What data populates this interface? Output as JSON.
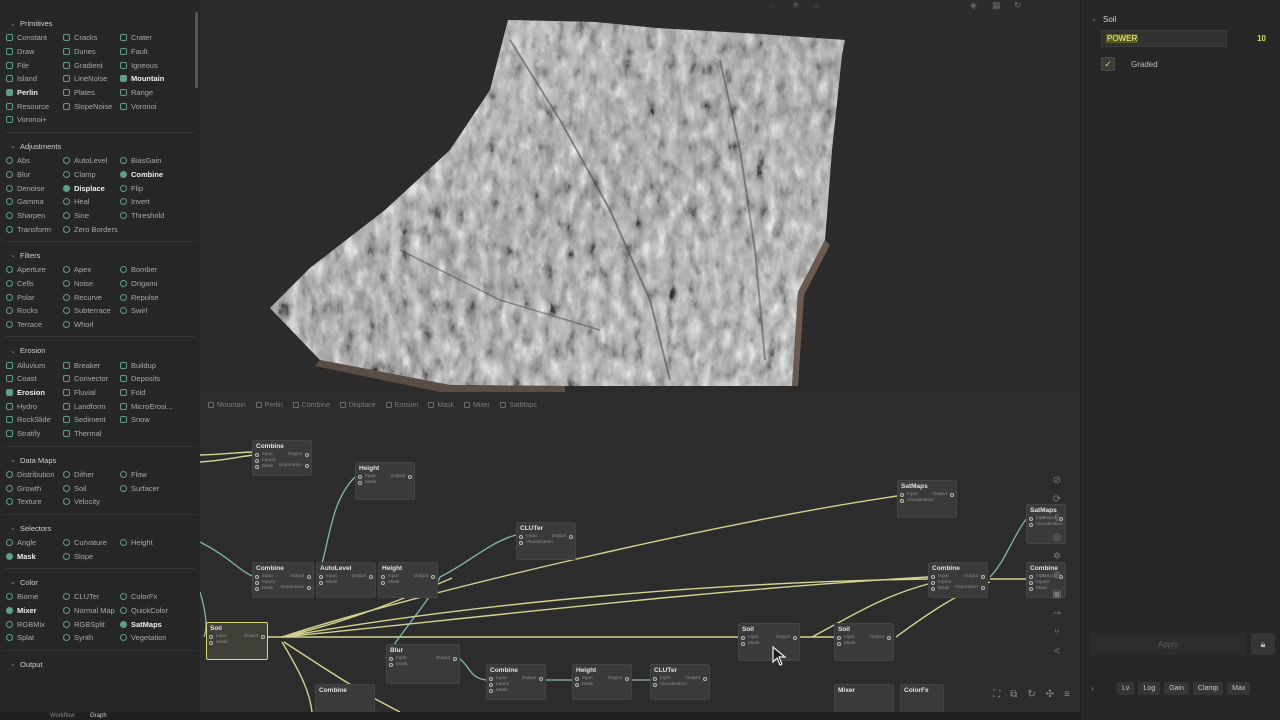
{
  "library": {
    "sections": [
      {
        "title": "Primitives",
        "icon": "square",
        "items": [
          "Constant",
          "Cracks",
          "Crater",
          "Draw",
          "Dunes",
          "Fault",
          "File",
          "Gradient",
          "Igneous",
          "Island",
          "LineNoise",
          "Mountain",
          "Perlin",
          "Plates",
          "Range",
          "Resource",
          "SlopeNoise",
          "Voronoi",
          "Voronoi+"
        ],
        "highlight": [
          "Mountain",
          "Perlin"
        ]
      },
      {
        "title": "Adjustments",
        "icon": "round",
        "items": [
          "Abs",
          "AutoLevel",
          "BiasGain",
          "Blur",
          "Clamp",
          "Combine",
          "Denoise",
          "Displace",
          "Flip",
          "Gamma",
          "Heal",
          "Invert",
          "Sharpen",
          "Sine",
          "Threshold",
          "Transform",
          "Zero Borders"
        ],
        "highlight": [
          "Combine",
          "Displace"
        ]
      },
      {
        "title": "Filters",
        "icon": "round",
        "items": [
          "Aperture",
          "Apex",
          "Bomber",
          "Cells",
          "Noise",
          "Origami",
          "Polar",
          "Recurve",
          "Repulse",
          "Rocks",
          "Subterrace",
          "Swirl",
          "Terrace",
          "Whorl"
        ],
        "highlight": []
      },
      {
        "title": "Erosion",
        "icon": "square",
        "items": [
          "Alluvium",
          "Breaker",
          "Buildup",
          "Coast",
          "Convector",
          "Deposits",
          "Erosion",
          "Fluvial",
          "Fold",
          "Hydro",
          "Landform",
          "MicroErosi...",
          "RockSlide",
          "Sediment",
          "Snow",
          "Stratify",
          "Thermal"
        ],
        "highlight": [
          "Erosion"
        ]
      },
      {
        "title": "Data Maps",
        "icon": "round",
        "items": [
          "Distribution",
          "Dither",
          "Flow",
          "Growth",
          "Soil",
          "Surfacer",
          "Texture",
          "Velocity"
        ],
        "highlight": []
      },
      {
        "title": "Selectors",
        "icon": "round",
        "items": [
          "Angle",
          "Curvature",
          "Height",
          "Mask",
          "Slope"
        ],
        "highlight": [
          "Mask"
        ]
      },
      {
        "title": "Color",
        "icon": "round",
        "items": [
          "Biome",
          "CLUTer",
          "ColorFx",
          "Mixer",
          "Normal Map",
          "QuickColor",
          "RGBMix",
          "RGBSplit",
          "SatMaps",
          "Splat",
          "Synth",
          "Vegetation"
        ],
        "highlight": [
          "Mixer",
          "SatMaps"
        ]
      },
      {
        "title": "Output",
        "icon": "round",
        "items": [],
        "highlight": []
      }
    ]
  },
  "graph": {
    "tabs": [
      "Mountain",
      "Perlin",
      "Combine",
      "Displace",
      "Erosion",
      "Mask",
      "Mixer",
      "SatMaps"
    ],
    "nodes": [
      {
        "id": "combine1",
        "title": "Combine",
        "ports": [
          "Input",
          "Input2",
          "Mask"
        ],
        "outputs": [
          "Output",
          "Separation"
        ]
      },
      {
        "id": "height1",
        "title": "Height",
        "ports": [
          "Input",
          "Mask"
        ],
        "outputs": [
          "Output"
        ]
      },
      {
        "id": "satmaps1",
        "title": "SatMaps",
        "ports": [
          "Input",
          "Visualization"
        ],
        "outputs": [
          "Output"
        ]
      },
      {
        "id": "cluter1",
        "title": "CLUTer",
        "ports": [
          "Input",
          "Visualization"
        ],
        "outputs": [
          "Output"
        ]
      },
      {
        "id": "combine2",
        "title": "Combine",
        "ports": [
          "Input",
          "Input2",
          "Mask"
        ],
        "outputs": [
          "Output",
          "Separation"
        ]
      },
      {
        "id": "autolevel1",
        "title": "AutoLevel",
        "ports": [
          "Input",
          "Mask"
        ],
        "outputs": [
          "Output"
        ]
      },
      {
        "id": "height2",
        "title": "Height",
        "ports": [
          "Input",
          "Mask"
        ],
        "outputs": [
          "Output"
        ]
      },
      {
        "id": "combine3",
        "title": "Combine",
        "ports": [
          "Input",
          "Input2",
          "Mask"
        ],
        "outputs": [
          "Output",
          "Separation"
        ]
      },
      {
        "id": "satmaps2",
        "title": "SatMaps",
        "ports": [
          "Input",
          "Visualization"
        ],
        "outputs": [
          "Output"
        ]
      },
      {
        "id": "combine4",
        "title": "Combine",
        "ports": [
          "Input",
          "Input2",
          "Mask"
        ],
        "outputs": [
          "Output"
        ]
      },
      {
        "id": "soil1",
        "title": "Soil",
        "ports": [
          "Input",
          "Mask"
        ],
        "outputs": [
          "Output"
        ]
      },
      {
        "id": "soil2",
        "title": "Soil",
        "ports": [
          "Input",
          "Mask"
        ],
        "outputs": [
          "Output"
        ]
      },
      {
        "id": "soil3",
        "title": "Soil",
        "ports": [
          "Input",
          "Mask"
        ],
        "outputs": [
          "Output"
        ]
      },
      {
        "id": "blur1",
        "title": "Blur",
        "ports": [
          "Input",
          "Mask"
        ],
        "outputs": [
          "Output"
        ]
      },
      {
        "id": "combine5",
        "title": "Combine",
        "ports": [
          "Input",
          "Input2",
          "Mask"
        ],
        "outputs": [
          "Output"
        ]
      },
      {
        "id": "height3",
        "title": "Height",
        "ports": [
          "Input",
          "Mask"
        ],
        "outputs": [
          "Output"
        ]
      },
      {
        "id": "cluter2",
        "title": "CLUTer",
        "ports": [
          "Input",
          "Visualization"
        ],
        "outputs": [
          "Output"
        ]
      },
      {
        "id": "combine6",
        "title": "Combine",
        "ports": [],
        "outputs": []
      },
      {
        "id": "mixer1",
        "title": "Mixer",
        "ports": [],
        "outputs": []
      },
      {
        "id": "colorfx1",
        "title": "ColorFx",
        "ports": [],
        "outputs": []
      }
    ],
    "selected_node": "soil1",
    "wire_colors": {
      "yellow": "#e6e69a",
      "teal": "#8fd0c4"
    }
  },
  "properties": {
    "section_title": "Soil",
    "param_label": "POWER",
    "param_value": "10",
    "graded_label": "Graded",
    "graded_checked": true,
    "apply_label": "Apply",
    "bottom_tabs": [
      "Lv",
      "Log",
      "Gain",
      "Clamp",
      "Max"
    ]
  },
  "statusbar": {
    "workflow_label": "Workflow",
    "graph_label": "Graph"
  },
  "colors": {
    "accent_teal": "#5f9e86",
    "accent_yellow": "#e0d860"
  }
}
